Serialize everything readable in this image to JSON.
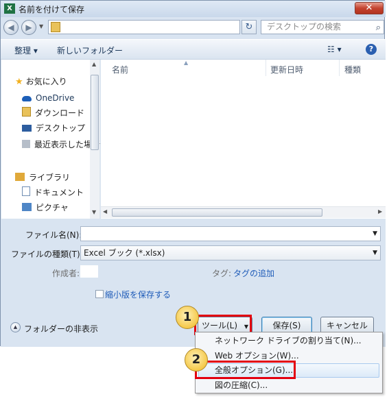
{
  "window": {
    "title": "名前を付けて保存",
    "close_label": "✕",
    "app_icon_label": "X"
  },
  "nav": {
    "back_label": "◀",
    "forward_label": "▶",
    "refresh_label": "↻",
    "search_placeholder": "デスクトップの検索",
    "search_icon": "⌕"
  },
  "toolbar": {
    "organize_label": "整理 ▾",
    "new_folder_label": "新しいフォルダー",
    "view_label": "☷ ▾",
    "help_label": "?"
  },
  "sidebar": {
    "items": [
      {
        "label": "お気に入り",
        "icon": "star-icon",
        "color": "#f2b01e"
      },
      {
        "label": "OneDrive",
        "icon": "cloud-icon",
        "color": "#1d5fb8"
      },
      {
        "label": "ダウンロード",
        "icon": "download-folder-icon",
        "color": "#3f7fd0"
      },
      {
        "label": "デスクトップ",
        "icon": "desktop-icon",
        "color": "#2d5d9f"
      },
      {
        "label": "最近表示した場所",
        "icon": "recent-places-icon",
        "color": "#8a8a8a"
      },
      {
        "label": "ライブラリ",
        "icon": "library-icon",
        "color": "#e0a93a"
      },
      {
        "label": "ドキュメント",
        "icon": "document-icon",
        "color": "#6f8db3"
      },
      {
        "label": "ピクチャ",
        "icon": "picture-icon",
        "color": "#4f86c6"
      }
    ]
  },
  "columns": {
    "name": "名前",
    "date": "更新日時",
    "type": "種類"
  },
  "form": {
    "filename_label": "ファイル名(N):",
    "filename_value": "",
    "filetype_label": "ファイルの種類(T):",
    "filetype_value": "Excel ブック (*.xlsx)",
    "author_label": "作成者:",
    "tag_label": "タグ:",
    "tag_link": "タグの追加",
    "thumbnail_label": "縮小版を保存する",
    "hide_folders_label": "フォルダーの非表示"
  },
  "buttons": {
    "tools": "ツール(L)",
    "save": "保存(S)",
    "cancel": "キャンセル"
  },
  "tools_menu": {
    "items": [
      "ネットワーク ドライブの割り当て(N)...",
      "Web オプション(W)...",
      "全般オプション(G)...",
      "図の圧縮(C)..."
    ]
  },
  "callouts": {
    "one": "1",
    "two": "2"
  },
  "colors": {
    "highlight": "#e3000f",
    "link": "#1e5bb8"
  }
}
